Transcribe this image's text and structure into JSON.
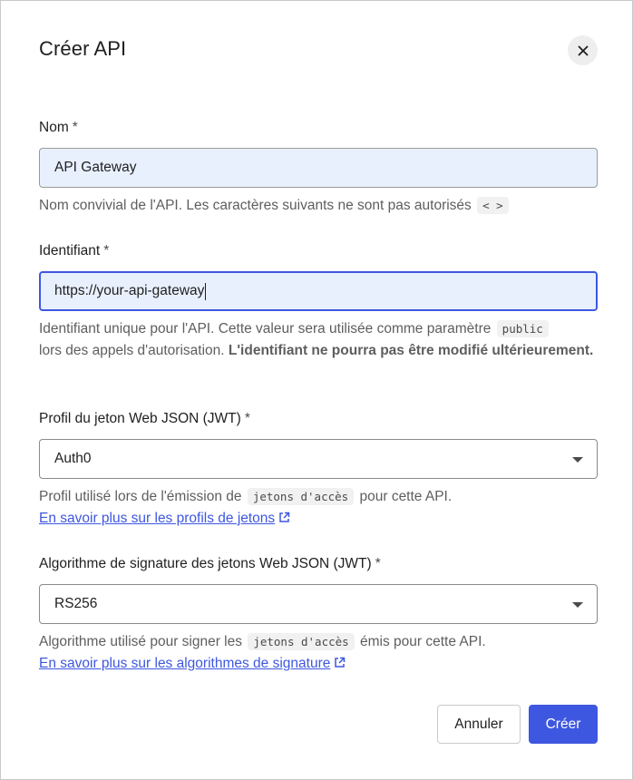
{
  "dialog": {
    "title": "Créer API",
    "close_icon": "close-icon"
  },
  "name_field": {
    "label": "Nom",
    "required_mark": "*",
    "value": "API Gateway",
    "help_text": "Nom convivial de l'API. Les caractères suivants ne sont pas autorisés",
    "help_code": "< >"
  },
  "identifier_field": {
    "label": "Identifiant",
    "required_mark": "*",
    "value": "https://your-api-gateway",
    "help_text_1": "Identifiant unique pour l'API. Cette valeur sera utilisée comme paramètre",
    "help_code": "public",
    "help_text_2": "lors des appels d'autorisation.",
    "help_bold": "L'identifiant ne pourra pas être modifié ultérieurement."
  },
  "jwt_profile_field": {
    "label": "Profil du jeton Web JSON (JWT)",
    "required_mark": "*",
    "selected": "Auth0",
    "help_text_1": "Profil utilisé lors de l'émission de",
    "help_code": "jetons d'accès",
    "help_text_2": "pour cette API.",
    "link_text": "En savoir plus sur les profils de jetons",
    "link_icon": "external-link-icon"
  },
  "signing_algo_field": {
    "label": "Algorithme de signature des jetons Web JSON (JWT)",
    "required_mark": "*",
    "selected": "RS256",
    "help_text_1": "Algorithme utilisé pour signer les",
    "help_code": "jetons d'accès",
    "help_text_2": "émis pour cette API.",
    "link_text": "En savoir plus sur les algorithmes de signature",
    "link_icon": "external-link-icon"
  },
  "actions": {
    "cancel_label": "Annuler",
    "create_label": "Créer"
  },
  "colors": {
    "accent": "#3e57e0",
    "autofill_bg": "#e8f0fe"
  }
}
